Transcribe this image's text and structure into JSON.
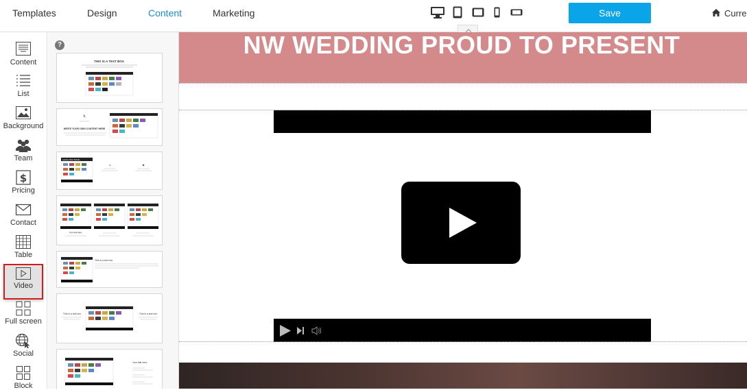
{
  "topbar": {
    "tabs": [
      {
        "label": "Templates",
        "active": false
      },
      {
        "label": "Design",
        "active": false
      },
      {
        "label": "Content",
        "active": true
      },
      {
        "label": "Marketing",
        "active": false
      }
    ],
    "devices": [
      "desktop-icon",
      "tablet-portrait-icon",
      "tablet-landscape-icon",
      "phone-portrait-icon",
      "phone-landscape-icon"
    ],
    "save_label": "Save",
    "current_label": "Curre"
  },
  "sidebar": {
    "items": [
      {
        "label": "Content",
        "icon": "content-icon"
      },
      {
        "label": "List",
        "icon": "list-icon"
      },
      {
        "label": "Background",
        "icon": "background-image-icon"
      },
      {
        "label": "Team",
        "icon": "team-icon"
      },
      {
        "label": "Pricing",
        "icon": "dollar-icon"
      },
      {
        "label": "Contact",
        "icon": "envelope-icon"
      },
      {
        "label": "Table",
        "icon": "table-grid-icon"
      },
      {
        "label": "Video",
        "icon": "video-play-icon",
        "selected": true
      },
      {
        "label": "Full screen",
        "icon": "fullscreen-icon"
      },
      {
        "label": "Social",
        "icon": "globe-cursor-icon"
      },
      {
        "label": "Block",
        "icon": "blocks-icon"
      }
    ]
  },
  "thumbs": {
    "help": "?",
    "items": [
      {
        "heading": "THIS IS A TEXT BOX"
      },
      {
        "heading": "WRITE YOUR OWN CONTENT HERE"
      },
      {
        "heading": "Landing Video Website"
      },
      {
        "heading": "Your title here"
      },
      {
        "heading": "This is a text box"
      },
      {
        "heading": "This is a text box"
      },
      {
        "heading": "Your title here"
      }
    ]
  },
  "canvas": {
    "hero_title": "NW WEDDING PROUD TO PRESENT",
    "colors": {
      "hero_bg": "#d48a8a",
      "save_btn": "#0aa5e8",
      "active_tab": "#1e88d6",
      "selected_outline": "#d21c1c"
    }
  }
}
